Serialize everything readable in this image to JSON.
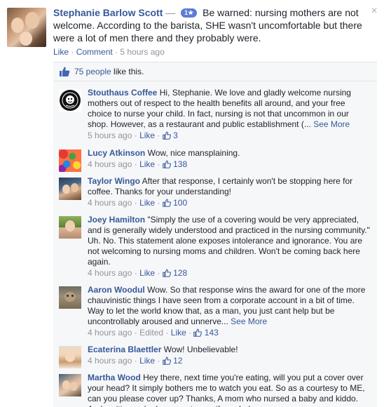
{
  "post": {
    "author": "Stephanie Barlow Scott",
    "dash": "—",
    "badge": "1★",
    "text": "Be warned: nursing mothers are not welcome. According to the barista, SHE wasn't uncomfortable but there were a lot of men there and they probably were.",
    "actions": {
      "like": "Like",
      "sep": " · ",
      "comment": "Comment",
      "time": "5 hours ago"
    },
    "likes": {
      "count_text": "75 people",
      "suffix": " like this."
    }
  },
  "comments": [
    {
      "author": "Stouthaus Coffee",
      "text": "Hi, Stephanie. We love and gladly welcome nursing mothers out of respect to the health benefits all around, and your free choice to nurse your child. In fact, nursing is not that uncommon in our shop. However, as a restaurant and public establishment (...",
      "see_more": "See More",
      "time": "5 hours ago",
      "like_label": "Like",
      "likes": "3",
      "avatar": "stouthaus-logo"
    },
    {
      "author": "Lucy Atkinson",
      "text": "Wow, nice mansplaining.",
      "time": "4 hours ago",
      "like_label": "Like",
      "likes": "138",
      "avatar": "ball-pit"
    },
    {
      "author": "Taylor Wingo",
      "text": "After that response, I certainly won't be stopping here for coffee. Thanks for your understanding!",
      "time": "4 hours ago",
      "like_label": "Like",
      "likes": "100",
      "avatar": "couple-photo"
    },
    {
      "author": "Joey Hamilton",
      "text": "\"Simply the use of a covering would be very appreciated, and is generally widely understood and practiced in the nursing community.\" Uh. No. This statement alone exposes intolerance and ignorance. You are not welcoming to nursing moms and children. Won't be coming back here again.",
      "time": "4 hours ago",
      "like_label": "Like",
      "likes": "128",
      "avatar": "person-photo"
    },
    {
      "author": "Aaron Woodul",
      "text": "Wow. So that response wins the award for one of the more chauvinistic things I have seen from a corporate account in a bit of time. Way to let the world know that, as a man, you just cant help but be uncontrollably aroused and unnerve...",
      "see_more": "See More",
      "time": "4 hours ago",
      "edited": "Edited",
      "like_label": "Like",
      "likes": "143",
      "avatar": "cat-photo"
    },
    {
      "author": "Ecaterina Blaettler",
      "text": "Wow! Unbelievable!",
      "time": "4 hours ago",
      "like_label": "Like",
      "likes": "12",
      "avatar": "child-photo"
    },
    {
      "author": "Martha Wood",
      "text": "Hey there, next time you're eating, will you put a cover over your head? It simply bothers me to watch you eat. So as a courtesy to ME, can you please cover up? Thanks, A mom who nursed a baby and kiddo. And a citizen who has ears to use if needed.",
      "time": "",
      "like_label": "",
      "likes": "",
      "avatar": "family-photo"
    }
  ],
  "meta_sep": " · ",
  "colors": {
    "link": "#365899",
    "meta": "#90949c",
    "panel": "#f6f7f9"
  }
}
